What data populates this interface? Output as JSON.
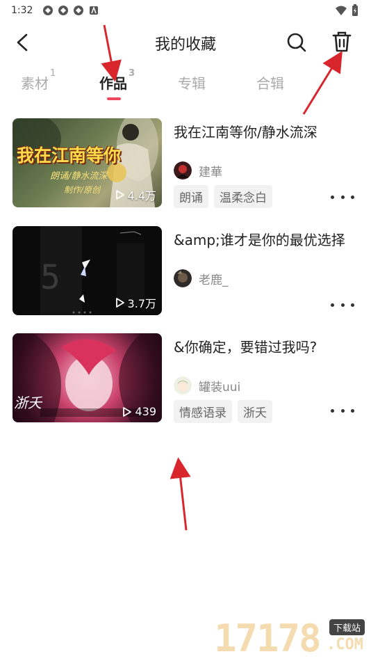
{
  "status_bar": {
    "time": "1:32"
  },
  "header": {
    "title": "我的收藏"
  },
  "tabs": [
    {
      "label": "素材",
      "count": "1"
    },
    {
      "label": "作品",
      "count": "3"
    },
    {
      "label": "专辑",
      "count": ""
    },
    {
      "label": "合辑",
      "count": ""
    }
  ],
  "items": [
    {
      "title": "我在江南等你/静水流深",
      "thumb_text_1": "我在江南等你",
      "thumb_text_2": "朗诵/静水流深",
      "thumb_text_3": "制作/原创",
      "plays": "4.4万",
      "author": "建華",
      "tags": [
        "朗诵",
        "温柔念白"
      ]
    },
    {
      "title": "&amp;谁才是你的最优选择",
      "thumb_text_1": "5",
      "plays": "3.7万",
      "author": "老鹿_",
      "tags": []
    },
    {
      "title": "&你确定，要错过我吗?",
      "thumb_text_1": "浙夭",
      "plays": "439",
      "author": "罐装uui",
      "tags": [
        "情感语录",
        "浙夭"
      ]
    }
  ],
  "watermark": {
    "number": "17178",
    "badge": "下载站",
    "domain": ".COM"
  },
  "colors": {
    "accent": "#f0475f",
    "arrow": "#d9262c"
  }
}
